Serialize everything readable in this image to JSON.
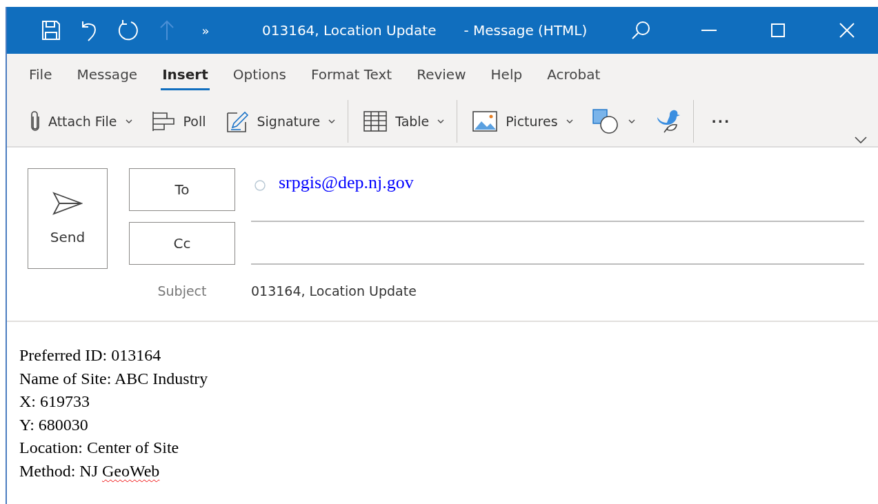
{
  "window": {
    "title": "013164, Location Update",
    "title_suffix": "-  Message (HTML)",
    "overflow_glyph": "»"
  },
  "tabs": [
    {
      "label": "File",
      "selected": false
    },
    {
      "label": "Message",
      "selected": false
    },
    {
      "label": "Insert",
      "selected": true
    },
    {
      "label": "Options",
      "selected": false
    },
    {
      "label": "Format Text",
      "selected": false
    },
    {
      "label": "Review",
      "selected": false
    },
    {
      "label": "Help",
      "selected": false
    },
    {
      "label": "Acrobat",
      "selected": false
    }
  ],
  "toolbar": [
    {
      "kind": "attach",
      "label": "Attach File",
      "dropdown": true
    },
    {
      "kind": "poll",
      "label": "Poll",
      "dropdown": false
    },
    {
      "kind": "signature",
      "label": "Signature",
      "dropdown": true
    },
    {
      "kind": "separator"
    },
    {
      "kind": "table",
      "label": "Table",
      "dropdown": true
    },
    {
      "kind": "separator"
    },
    {
      "kind": "pictures",
      "label": "Pictures",
      "dropdown": true
    },
    {
      "kind": "shapes",
      "dropdown": true
    },
    {
      "kind": "bird",
      "dropdown": false
    },
    {
      "kind": "separator"
    },
    {
      "kind": "more",
      "label": "···"
    }
  ],
  "compose": {
    "send": "Send",
    "to_button": "To",
    "cc_button": "Cc",
    "to_value": "srpgis@dep.nj.gov",
    "subject_label": "Subject",
    "subject_value": "013164, Location Update"
  },
  "body": [
    {
      "text": "Preferred ID: 013164"
    },
    {
      "text": "Name of Site: ABC Industry"
    },
    {
      "text": "X: 619733"
    },
    {
      "text": "Y: 680030"
    },
    {
      "text": "Location: Center of Site"
    },
    {
      "text": "Method: NJ",
      "misspelled_word": "GeoWeb"
    }
  ]
}
